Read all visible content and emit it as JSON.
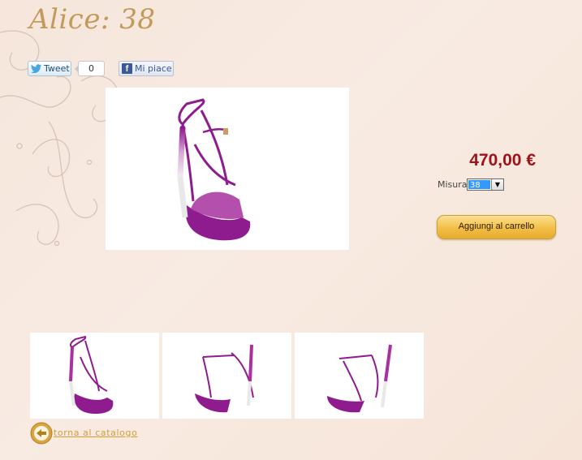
{
  "product": {
    "title": "Alice: 38",
    "price": "470,00 €",
    "size_label": "Misura",
    "size_selected": "38",
    "add_to_cart_label": "Aggiungi al carrello"
  },
  "social": {
    "tweet_label": "Tweet",
    "tweet_count": "0",
    "like_label": "Mi piace"
  },
  "navigation": {
    "back_label": "torna al catalogo"
  },
  "colors": {
    "price": "#a0121a",
    "title": "#c39a5a",
    "shoe": "#8e1c8e",
    "cart_button": "#f2be46"
  }
}
